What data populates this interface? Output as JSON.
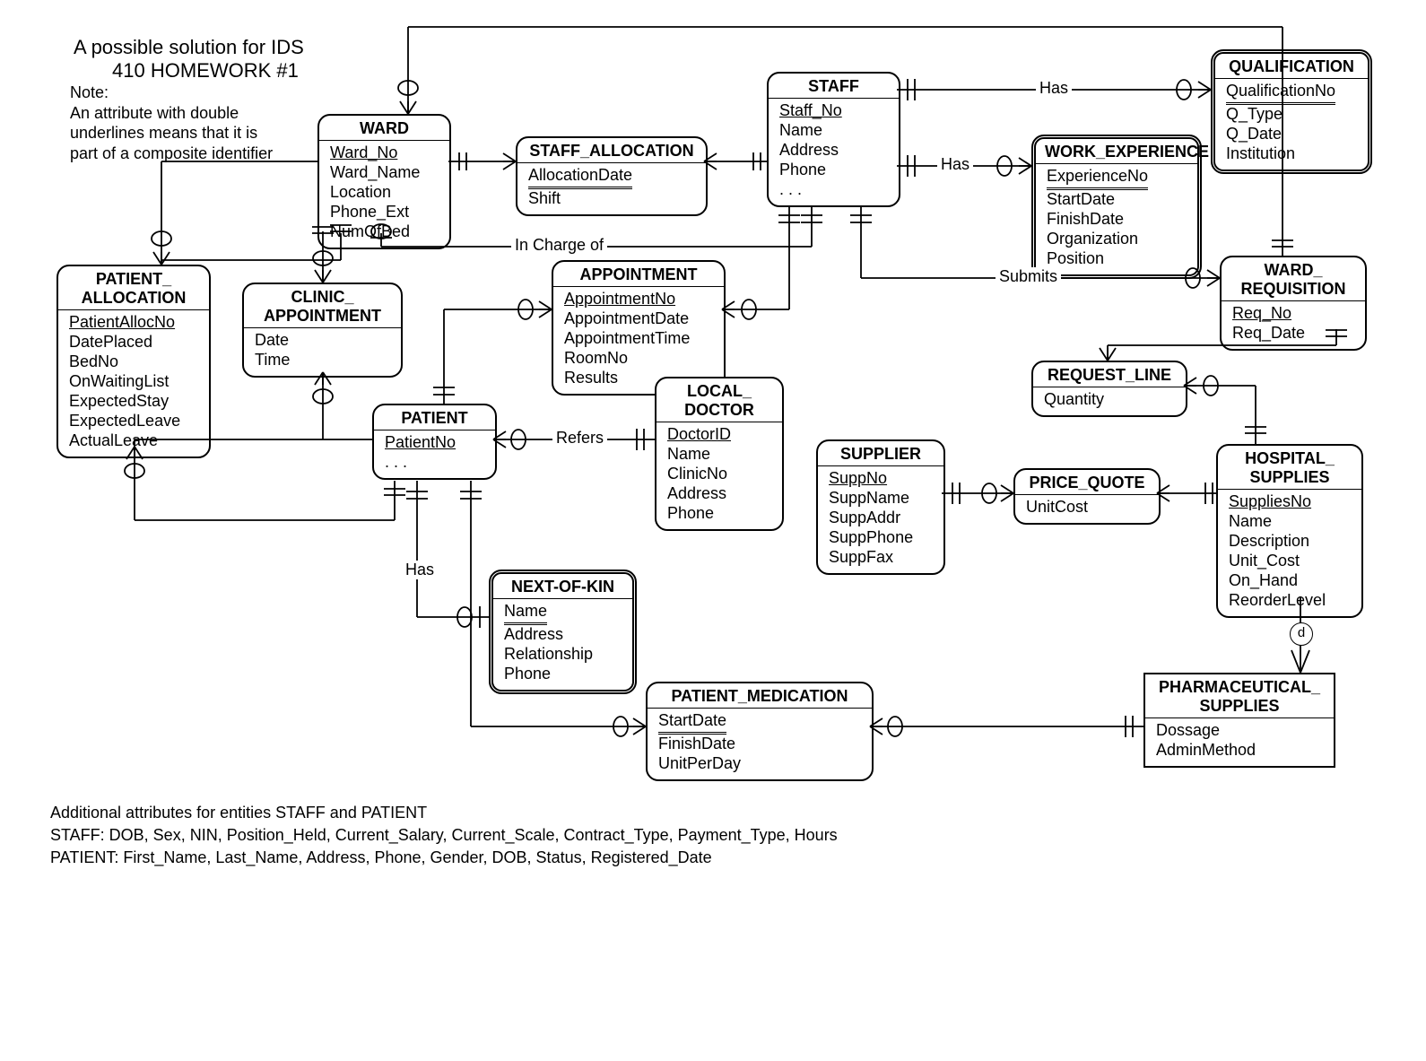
{
  "chart_data": {
    "type": "er_diagram",
    "title1": "A possible solution for IDS",
    "title2": "410 HOMEWORK #1",
    "note": "Note:\nAn attribute with double underlines  means that it is part of a composite identifier",
    "footer": [
      "Additional attributes for entities STAFF and PATIENT",
      "STAFF: DOB, Sex, NIN, Position_Held, Current_Salary, Current_Scale, Contract_Type, Payment_Type, Hours",
      "PATIENT: First_Name, Last_Name, Address, Phone, Gender, DOB, Status, Registered_Date"
    ],
    "entities": {
      "patient_allocation": {
        "name": "PATIENT_\nALLOCATION",
        "attrs": [
          {
            "t": "PatientAllocNo",
            "k": "pk"
          },
          {
            "t": "DatePlaced"
          },
          {
            "t": "BedNo"
          },
          {
            "t": "OnWaitingList"
          },
          {
            "t": "ExpectedStay"
          },
          {
            "t": "ExpectedLeave"
          },
          {
            "t": "ActualLeave"
          }
        ]
      },
      "ward": {
        "name": "WARD",
        "attrs": [
          {
            "t": "Ward_No",
            "k": "pk"
          },
          {
            "t": "Ward_Name"
          },
          {
            "t": "Location"
          },
          {
            "t": "Phone_Ext"
          },
          {
            "t": "NumOfBed"
          }
        ]
      },
      "clinic_appointment": {
        "name": "CLINIC_\nAPPOINTMENT",
        "attrs": [
          {
            "t": "Date"
          },
          {
            "t": "Time"
          }
        ]
      },
      "staff_allocation": {
        "name": "STAFF_ALLOCATION",
        "attrs": [
          {
            "t": "AllocationDate",
            "k": "cid"
          },
          {
            "t": "Shift"
          }
        ]
      },
      "staff": {
        "name": "STAFF",
        "attrs": [
          {
            "t": "Staff_No",
            "k": "pk"
          },
          {
            "t": "Name"
          },
          {
            "t": "Address"
          },
          {
            "t": "Phone"
          },
          {
            "t": ". . ."
          }
        ]
      },
      "qualification": {
        "name": "QUALIFICATION",
        "weak": true,
        "attrs": [
          {
            "t": "QualificationNo",
            "k": "cid"
          },
          {
            "t": "Q_Type"
          },
          {
            "t": "Q_Date"
          },
          {
            "t": "Institution"
          }
        ]
      },
      "work_experience": {
        "name": "WORK_EXPERIENCE",
        "weak": true,
        "attrs": [
          {
            "t": "ExperienceNo",
            "k": "cid"
          },
          {
            "t": "StartDate"
          },
          {
            "t": "FinishDate"
          },
          {
            "t": "Organization"
          },
          {
            "t": "Position"
          }
        ]
      },
      "appointment": {
        "name": "APPOINTMENT",
        "attrs": [
          {
            "t": "AppointmentNo",
            "k": "pk"
          },
          {
            "t": "AppointmentDate"
          },
          {
            "t": "AppointmentTime"
          },
          {
            "t": "RoomNo"
          },
          {
            "t": "Results"
          }
        ]
      },
      "patient": {
        "name": "PATIENT",
        "attrs": [
          {
            "t": "PatientNo",
            "k": "pk"
          },
          {
            "t": ". . ."
          }
        ]
      },
      "local_doctor": {
        "name": "LOCAL_\nDOCTOR",
        "attrs": [
          {
            "t": "DoctorID",
            "k": "pk"
          },
          {
            "t": "Name"
          },
          {
            "t": "ClinicNo"
          },
          {
            "t": "Address"
          },
          {
            "t": "Phone"
          }
        ]
      },
      "next_of_kin": {
        "name": "NEXT-OF-KIN",
        "weak": true,
        "attrs": [
          {
            "t": "Name",
            "k": "cid"
          },
          {
            "t": "Address"
          },
          {
            "t": "Relationship"
          },
          {
            "t": "Phone"
          }
        ]
      },
      "supplier": {
        "name": "SUPPLIER",
        "attrs": [
          {
            "t": "SuppNo",
            "k": "pk"
          },
          {
            "t": "SuppName"
          },
          {
            "t": "SuppAddr"
          },
          {
            "t": "SuppPhone"
          },
          {
            "t": "SuppFax"
          }
        ]
      },
      "price_quote": {
        "name": "PRICE_QUOTE",
        "attrs": [
          {
            "t": "UnitCost"
          }
        ]
      },
      "ward_requisition": {
        "name": "WARD_\nREQUISITION",
        "attrs": [
          {
            "t": "Req_No",
            "k": "pk"
          },
          {
            "t": "Req_Date"
          }
        ]
      },
      "request_line": {
        "name": "REQUEST_LINE",
        "attrs": [
          {
            "t": "Quantity"
          }
        ]
      },
      "hospital_supplies": {
        "name": "HOSPITAL_\nSUPPLIES",
        "attrs": [
          {
            "t": "SuppliesNo",
            "k": "pk"
          },
          {
            "t": "Name"
          },
          {
            "t": "Description"
          },
          {
            "t": "Unit_Cost"
          },
          {
            "t": "On_Hand"
          },
          {
            "t": "ReorderLevel"
          }
        ]
      },
      "patient_medication": {
        "name": "PATIENT_MEDICATION",
        "attrs": [
          {
            "t": "StartDate",
            "k": "cid"
          },
          {
            "t": "FinishDate"
          },
          {
            "t": "UnitPerDay"
          }
        ]
      },
      "pharmaceutical_supplies": {
        "name": "PHARMACEUTICAL_\nSUPPLIES",
        "sub": true,
        "attrs": [
          {
            "t": "Dossage"
          },
          {
            "t": "AdminMethod"
          }
        ]
      }
    },
    "relationships": [
      {
        "label": "Has",
        "between": [
          "STAFF",
          "QUALIFICATION"
        ]
      },
      {
        "label": "Has",
        "between": [
          "STAFF",
          "WORK_EXPERIENCE"
        ]
      },
      {
        "label": "In Charge of",
        "between": [
          "STAFF",
          "WARD"
        ]
      },
      {
        "label": "Submits",
        "between": [
          "STAFF",
          "WARD_REQUISITION"
        ]
      },
      {
        "label": "Refers",
        "between": [
          "PATIENT",
          "LOCAL_DOCTOR"
        ]
      },
      {
        "label": "Has",
        "between": [
          "PATIENT",
          "NEXT-OF-KIN"
        ]
      },
      {
        "type": "subtype",
        "label": "d",
        "between": [
          "HOSPITAL_SUPPLIES",
          "PHARMACEUTICAL_SUPPLIES"
        ]
      }
    ]
  }
}
